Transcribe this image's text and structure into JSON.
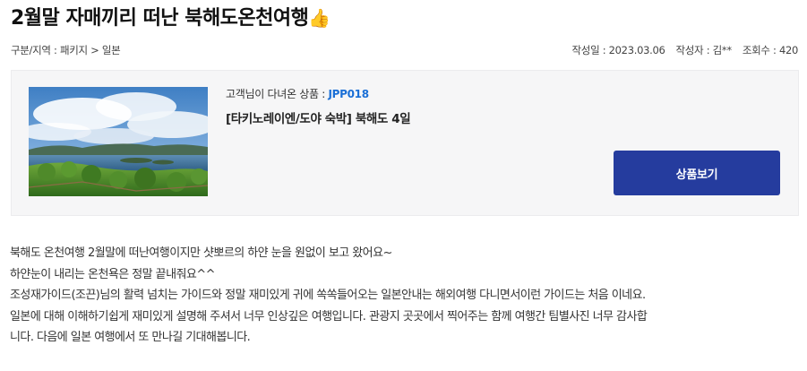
{
  "post": {
    "title": "2월말 자매끼리 떠난 북해도온천여행",
    "title_emoji": "👍",
    "category_label": "구분/지역 : 패키지 > 일본",
    "date_label": "작성일 : 2023.03.06",
    "author_label": "작성자 : 김**",
    "views_label": "조회수 : 420"
  },
  "product": {
    "visit_prefix": "고객님이 다녀온 상품 : ",
    "code": "JPP018",
    "name": "[타키노레이엔/도야 숙박] 북해도 4일",
    "view_button": "상품보기",
    "image_alt": "북해도 풍경 사진"
  },
  "body": {
    "lines": [
      "북해도 온천여행 2월말에 떠난여행이지만 샷뽀르의 하얀 눈을 원없이 보고 왔어요~",
      "하얀눈이 내리는 온천욕은 정말 끝내줘요^^",
      "조성재가이드(조끈)님의 활력 넘치는 가이드와 정말 재미있게 귀에 쏙쏙들어오는 일본안내는 해외여행 다니면서이런 가이드는 처음 이네요.",
      "일본에 대해 이해하기쉽게 재미있게 설명해 주셔서 너무 인상깊은 여행입니다. 관광지 곳곳에서 찍어주는 함께 여행간 팀별사진 너무 감사합",
      "니다. 다음에 일본 여행에서 또 만나길 기대해봅니다."
    ]
  },
  "colors": {
    "button": "#253c9e",
    "code": "#1a6fd6",
    "box": "#f6f6f7"
  }
}
